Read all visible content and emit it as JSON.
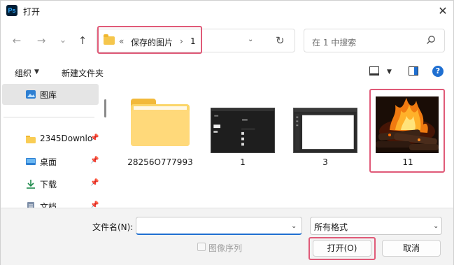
{
  "window": {
    "title": "打开",
    "app_icon_text": "Ps"
  },
  "nav": {
    "back": "←",
    "forward": "→",
    "recent": "⌄",
    "up": "↑"
  },
  "address": {
    "overflow": "«",
    "crumbs": [
      "保存的图片",
      "1"
    ],
    "separator": "›"
  },
  "search": {
    "placeholder": "在 1 中搜索"
  },
  "toolbar": {
    "organize": "组织",
    "new_folder": "新建文件夹"
  },
  "sidebar": {
    "items": [
      {
        "label": "图库",
        "icon": "gallery-icon",
        "selected": true
      },
      {
        "label": "2345Downlo",
        "icon": "folder-icon"
      },
      {
        "label": "桌面",
        "icon": "desktop-icon"
      },
      {
        "label": "下载",
        "icon": "download-icon"
      },
      {
        "label": "文档",
        "icon": "document-icon"
      }
    ]
  },
  "files": [
    {
      "name": "28256O777993",
      "type": "folder"
    },
    {
      "name": "1",
      "type": "image"
    },
    {
      "name": "3",
      "type": "image"
    },
    {
      "name": "11",
      "type": "image",
      "selected": true
    }
  ],
  "bottom": {
    "filename_label": "文件名(N):",
    "filename_value": "",
    "filter_value": "所有格式",
    "image_sequence_label": "图像序列",
    "open_button": "打开(O)",
    "cancel_button": "取消"
  },
  "colors": {
    "accent": "#1f6fd1",
    "highlight": "#e05a78",
    "folder": "#fbd66a"
  }
}
